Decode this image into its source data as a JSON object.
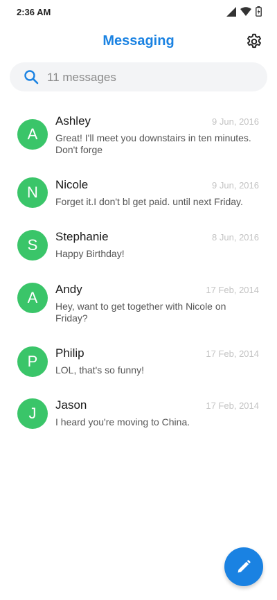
{
  "status_bar": {
    "time": "2:36 AM"
  },
  "header": {
    "title": "Messaging",
    "settings_icon": "gear-icon",
    "accent_color": "#1a82e2"
  },
  "search": {
    "placeholder": "11 messages",
    "icon": "search-icon"
  },
  "messages": [
    {
      "initial": "A",
      "name": "Ashley",
      "date": "9 Jun, 2016",
      "preview": "Great! I'll meet you downstairs in ten minutes. Don't forge"
    },
    {
      "initial": "N",
      "name": "Nicole",
      "date": "9 Jun, 2016",
      "preview": "Forget it.I don't bl get paid. until next Friday."
    },
    {
      "initial": "S",
      "name": "Stephanie",
      "date": "8 Jun, 2016",
      "preview": "Happy Birthday!"
    },
    {
      "initial": "A",
      "name": "Andy",
      "date": "17 Feb, 2014",
      "preview": "Hey, want to get together with Nicole on Friday?"
    },
    {
      "initial": "P",
      "name": "Philip",
      "date": "17 Feb, 2014",
      "preview": "LOL, that's so funny!"
    },
    {
      "initial": "J",
      "name": "Jason",
      "date": "17 Feb, 2014",
      "preview": "I heard you're moving to China."
    }
  ],
  "avatar_color": "#3ac569",
  "fab": {
    "icon": "pencil-icon"
  }
}
